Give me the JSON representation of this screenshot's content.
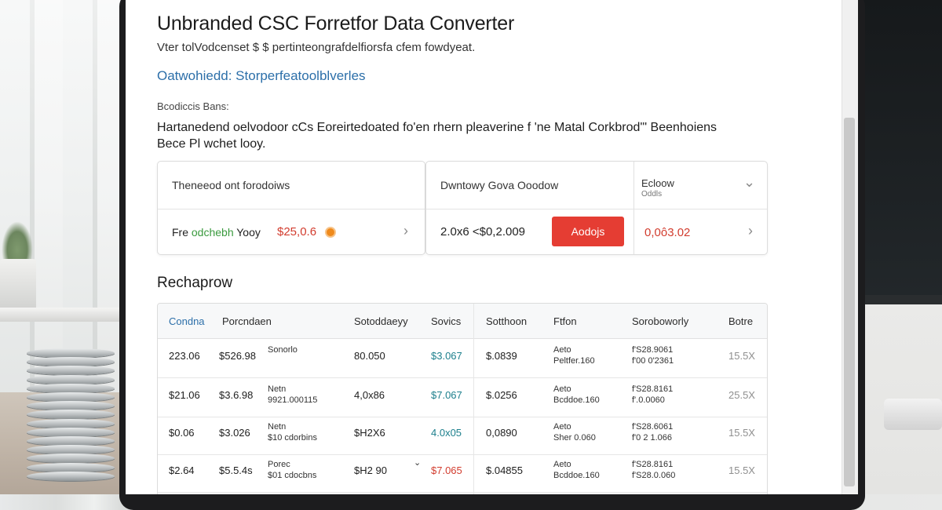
{
  "page": {
    "title": "Unbranded CSC Forretfor Data Converter",
    "subtitle": "Vter tolVodcenset $ $ pertinteongrafdelfiorsfa cfem fowdyeat.",
    "link": "Oatwohiedd: Storperfeatoolblverles",
    "section_label": "Bcodiccis Bans:",
    "description_line1": "Hartanedend oelvodoor cCs Eoreirtedoated fo'en rhern pleaverine f 'ne Matal Corkbrod'\" Beenhoiens",
    "description_line2": "Bece Pl wchet looy."
  },
  "card_left": {
    "header": "Theneeod ont forodoiws",
    "label_prefix": "Fre",
    "label_green": "odchebh",
    "label_suffix": "Yooy",
    "price": "$25,0.6",
    "chevron": "›"
  },
  "card_right": {
    "header": "Dwntowy Gova Ooodow",
    "value": "2.0x6 <$0,2.009",
    "button_label": "Aodojs",
    "dropdown_label": "Ecloow",
    "dropdown_sublabel": "Oddls",
    "dropdown_chevron": "⌄",
    "result_value": "0,0ô3.02",
    "chevron": "›"
  },
  "section_title": "Rechaprow",
  "table": {
    "headers": [
      "Condna",
      "Porcndaen",
      "Sotoddaeyy",
      "Sovics",
      "Sotthoon",
      "Ftfon",
      "Soroboworly",
      "Botre"
    ],
    "rows": [
      {
        "c1": "223.06",
        "c2": "$526.98",
        "c3_a": "Sonorlo",
        "c3_b": "",
        "c4": "80.050",
        "c5": "$3.067",
        "c6": "$.0839",
        "c7_a": "Aeto",
        "c7_b": "Peltfer.160",
        "c8_a": "f'S28.9061",
        "c8_b": "f'00 0'2361",
        "c9": "15.5X",
        "c5_color": "teal",
        "c4_note": ""
      },
      {
        "c1": "$21.06",
        "c2": "$3.6.98",
        "c3_a": "Netn",
        "c3_b": "9921.000115",
        "c4": "4,0x86",
        "c5": "$7.067",
        "c6": "$.0256",
        "c7_a": "Aeto",
        "c7_b": "Bcddoe.160",
        "c8_a": "f'S28.8161",
        "c8_b": "f'.0.0060",
        "c9": "25.5X",
        "c5_color": "teal",
        "c4_note": ""
      },
      {
        "c1": "$0.06",
        "c2": "$3.026",
        "c3_a": "Netn",
        "c3_b": "$10 cdorbins",
        "c4": "$H2X6",
        "c5": "4.0x05",
        "c6": "0,0890",
        "c7_a": "Aeto",
        "c7_b": "Sher 0.060",
        "c8_a": "f'S28.6061",
        "c8_b": "f'0 2 1.066",
        "c9": "15.5X",
        "c5_color": "teal",
        "c4_note": ""
      },
      {
        "c1": "$2.64",
        "c2": "$5.5.4s",
        "c3_a": "Porec",
        "c3_b": "$01 cdocbns",
        "c4": "$H2 90",
        "c5": "$7.065",
        "c6": "$.04855",
        "c7_a": "Aeto",
        "c7_b": "Bcddoe.160",
        "c8_a": "f'S28.8161",
        "c8_b": "f'S28.0.060",
        "c9": "15.5X",
        "c5_color": "red",
        "c4_note": "⌄"
      }
    ]
  }
}
